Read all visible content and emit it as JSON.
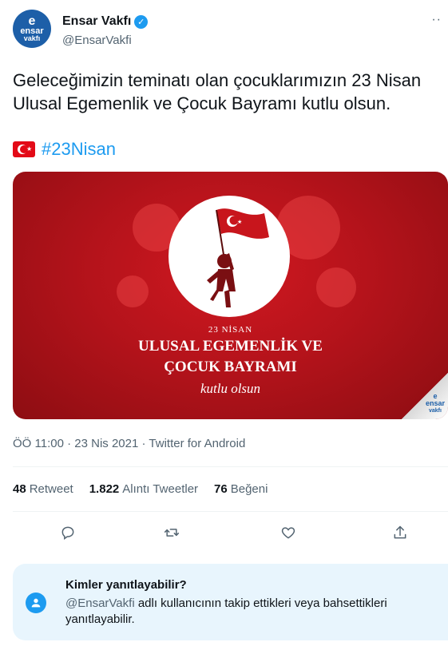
{
  "author": {
    "name": "Ensar Vakfı",
    "handle": "@EnsarVakfi",
    "avatar_lines": [
      "e",
      "ensar",
      "vakfı"
    ]
  },
  "tweet": {
    "text": "Geleceğimizin teminatı olan çocuklarımızın 23 Nisan Ulusal Egemenlik ve Çocuk Bayramı kutlu olsun.",
    "hashtag": "#23Nisan"
  },
  "media": {
    "date_line": "23 NİSAN",
    "title_line1": "ULUSAL EGEMENLİK VE",
    "title_line2": "ÇOCUK BAYRAMI",
    "script_line": "kutlu olsun",
    "corner_logo": [
      "e",
      "ensar",
      "vakfı"
    ]
  },
  "meta": {
    "time": "ÖÖ 11:00",
    "date": "23 Nis 2021",
    "source": "Twitter for Android"
  },
  "stats": {
    "retweets_count": "48",
    "retweets_label": "Retweet",
    "quotes_count": "1.822",
    "quotes_label": "Alıntı Tweetler",
    "likes_count": "76",
    "likes_label": "Beğeni"
  },
  "reply_settings": {
    "title": "Kimler yanıtlayabilir?",
    "mention": "@EnsarVakfi",
    "desc": " adlı kullanıcının takip ettikleri veya bahsettikleri yanıtlayabilir."
  },
  "icons": {
    "reply": "reply-icon",
    "retweet": "retweet-icon",
    "like": "heart-icon",
    "share": "share-icon"
  },
  "colors": {
    "accent": "#1d9bf0",
    "brand": "#1d5fa8",
    "banner_red": "#c8151c"
  }
}
